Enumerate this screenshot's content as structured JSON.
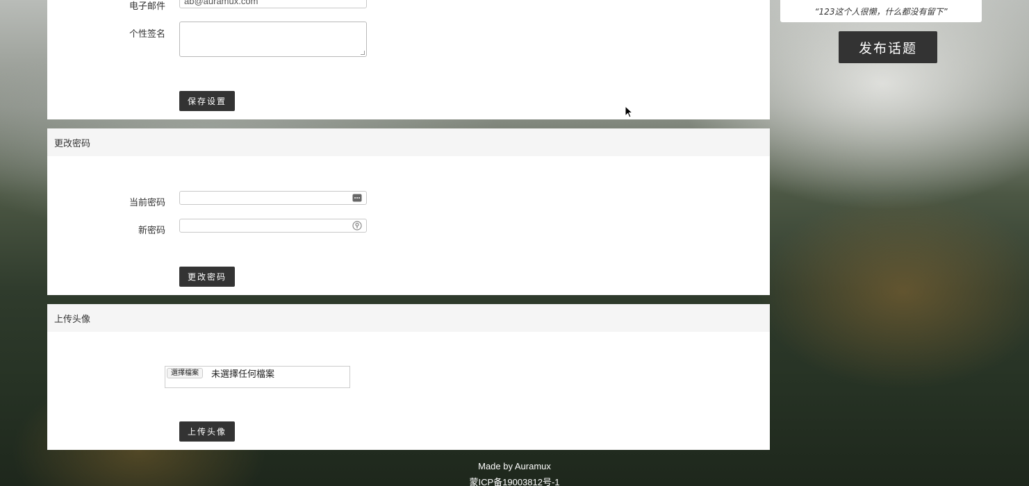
{
  "profile_form": {
    "email_label": "电子邮件",
    "email_value": "ab@auramux.com",
    "signature_label": "个性签名",
    "signature_value": "",
    "save_button": "保存设置"
  },
  "password_panel": {
    "title": "更改密码",
    "current_label": "当前密码",
    "new_label": "新密码",
    "submit_button": "更改密码"
  },
  "avatar_panel": {
    "title": "上传头像",
    "choose_file_button": "選擇檔案",
    "file_status": "未選擇任何檔案",
    "upload_button": "上传头像"
  },
  "sidebar": {
    "signature_quote": "“123这个人很懒，什么都没有留下”",
    "publish_button": "发布话题"
  },
  "footer": {
    "made_by": "Made by Auramux",
    "icp": "蒙ICP备19003812号-1"
  }
}
